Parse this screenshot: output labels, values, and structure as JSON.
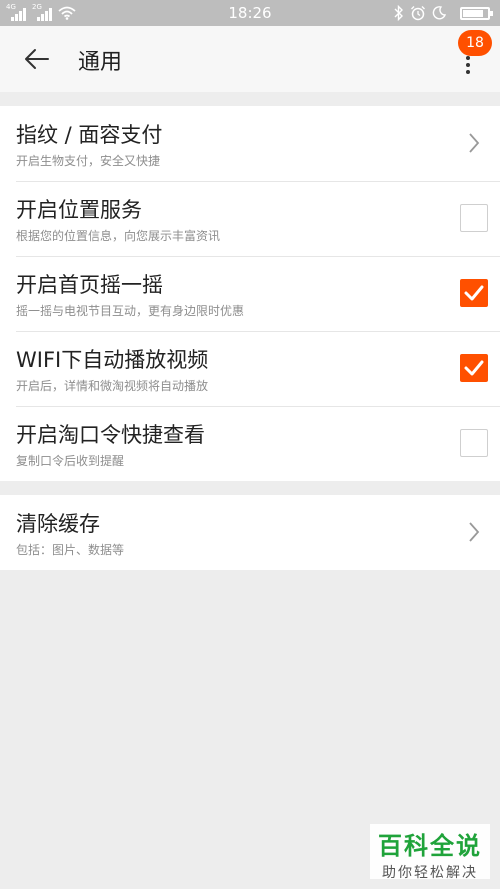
{
  "status_bar": {
    "sim1": "4G",
    "sim2": "2G",
    "time": "18:26",
    "battery_level": 0.85
  },
  "header": {
    "title": "通用",
    "badge_count": "18"
  },
  "settings": [
    {
      "title": "指纹 / 面容支付",
      "subtitle": "开启生物支付，安全又快捷",
      "control": "chevron"
    },
    {
      "title": "开启位置服务",
      "subtitle": "根据您的位置信息，向您展示丰富资讯",
      "control": "checkbox",
      "checked": false
    },
    {
      "title": "开启首页摇一摇",
      "subtitle": "摇一摇与电视节目互动，更有身边限时优惠",
      "control": "checkbox",
      "checked": true
    },
    {
      "title": "WIFI下自动播放视频",
      "subtitle": "开启后，详情和微淘视频将自动播放",
      "control": "checkbox",
      "checked": true
    },
    {
      "title": "开启淘口令快捷查看",
      "subtitle": "复制口令后收到提醒",
      "control": "checkbox",
      "checked": false
    }
  ],
  "cache": {
    "title": "清除缓存",
    "subtitle": "包括：图片、数据等"
  },
  "watermark": {
    "main": "百科全说",
    "sub": "助你轻松解决"
  },
  "colors": {
    "accent": "#ff5000",
    "status_bar": "#bdbdbd",
    "background": "#ededed"
  }
}
